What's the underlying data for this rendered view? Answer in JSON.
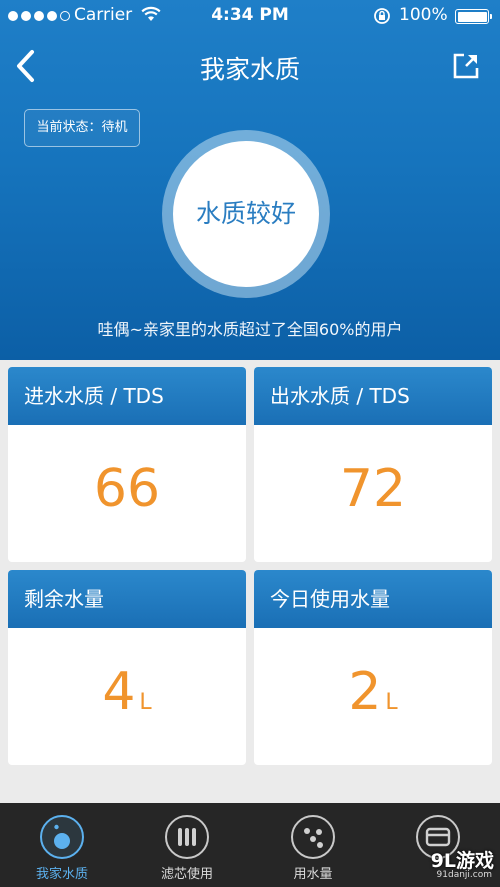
{
  "status_bar": {
    "carrier": "Carrier",
    "time": "4:34 PM",
    "battery_percent": "100%",
    "signal_bars_filled": 4,
    "signal_bars_total": 5,
    "battery_level": 1.0
  },
  "header": {
    "title": "我家水质",
    "back_icon": "chevron-left-icon",
    "share_icon": "share-icon"
  },
  "hero": {
    "state_text": "当前状态：待机",
    "quality_label": "水质较好",
    "hint": "哇偶~亲家里的水质超过了全国60%的用户"
  },
  "cards": [
    {
      "title": "进水水质 / TDS",
      "value": "66",
      "unit": ""
    },
    {
      "title": "出水水质 / TDS",
      "value": "72",
      "unit": ""
    },
    {
      "title": "剩余水量",
      "value": "4",
      "unit": "L"
    },
    {
      "title": "今日使用水量",
      "value": "2",
      "unit": "L"
    }
  ],
  "tabbar": {
    "items": [
      {
        "label": "我家水质",
        "icon": "water-drop-icon",
        "active": true
      },
      {
        "label": "滤芯使用",
        "icon": "filter-icon",
        "active": false
      },
      {
        "label": "用水量",
        "icon": "usage-dots-icon",
        "active": false
      },
      {
        "label": "",
        "icon": "card-icon",
        "active": false
      }
    ]
  },
  "watermark": {
    "logo": "9L游戏",
    "url": "91danji.com"
  },
  "colors": {
    "primary_blue": "#1674bd",
    "value_orange": "#f0942d",
    "active_tab": "#5cb1ef",
    "tabbar_bg": "#262626"
  }
}
